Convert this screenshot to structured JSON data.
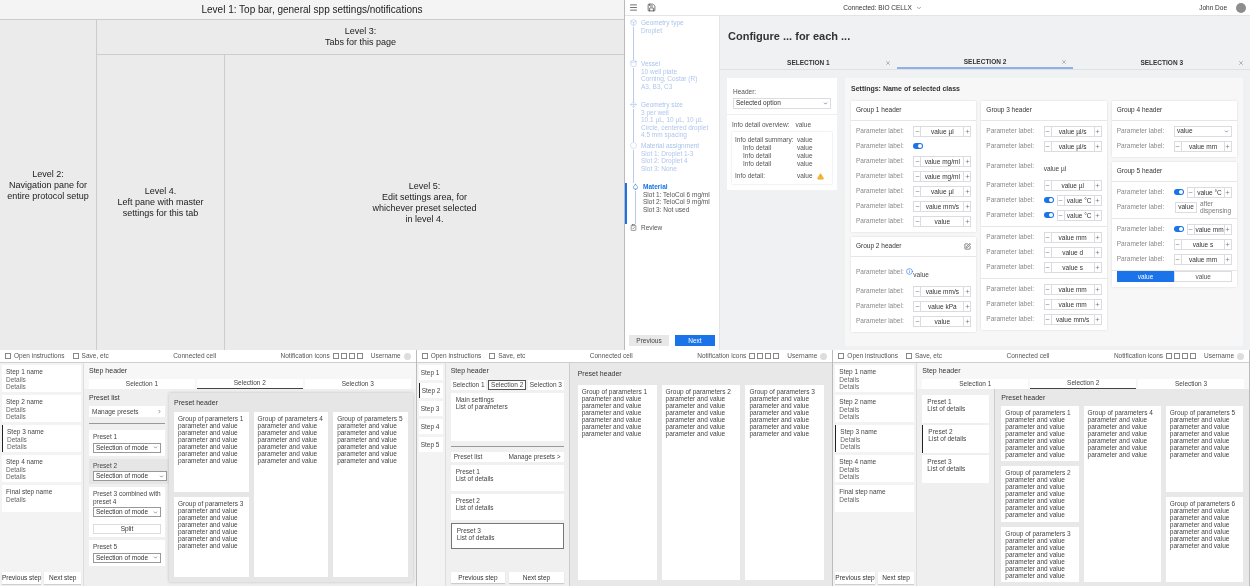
{
  "overview": {
    "level_1": "Level 1: Top bar, general spp settings/notifications",
    "level_2": "Level 2:\nNavigation pane for\nentire protocol setup",
    "level_3": "Level 3:\nTabs for this page",
    "level_4": "Level 4.\nLeft pane with master\nsettings for this tab",
    "level_5": "Level 5:\nEdit settings area, for\nwhichever preset selected\nin level 4."
  },
  "mockup": {
    "top_bar": {
      "connection": "Connected: BIO CELLX",
      "user": "John Doe"
    },
    "steps": [
      {
        "title": "Geometry type",
        "details": [
          "Droplet"
        ],
        "done": true,
        "selected": false
      },
      {
        "title": "Vessel",
        "details": [
          "10 well plate",
          "Corning, Costar (R)",
          "A3, B3, C3"
        ],
        "done": true,
        "selected": false
      },
      {
        "title": "Geometry size",
        "details": [
          "3 per well",
          "10.1 µL, 10 µL, 10 µL",
          "Circle, centered droplet",
          "4.5 mm spacing"
        ],
        "done": true,
        "selected": false
      },
      {
        "title": "Material assignment",
        "details": [
          "Slot 1: Droplet 1-3",
          "Slot 2: Droplet 4",
          "Slot 3: None"
        ],
        "done": true,
        "selected": false
      },
      {
        "title": "Material",
        "details": [
          "Slot 1: TeloCol 6 mg/ml",
          "Slot 2: TeloCol 9 mg/ml",
          "Slot 3: Not used"
        ],
        "done": false,
        "selected": true
      },
      {
        "title": "Review",
        "done": false,
        "selected": false
      }
    ],
    "previous": "Previous",
    "next": "Next",
    "title": "Configure ... for each ...",
    "tabs": [
      {
        "label": "SELECTION 1",
        "selected": false
      },
      {
        "label": "SELECTION 2",
        "selected": true
      },
      {
        "label": "SELECTION 3",
        "selected": false
      }
    ],
    "summary": {
      "header_label": "Header:",
      "dropdown": "Selected option",
      "overview_label": "Info detail overview:",
      "overview_value": "value",
      "details": [
        {
          "kind": "summary",
          "label": "Info detail summary:",
          "value": "value"
        },
        {
          "kind": "detail",
          "label": "Info detail",
          "value": "value"
        },
        {
          "kind": "detail",
          "label": "Info detail",
          "value": "value"
        },
        {
          "kind": "detail",
          "label": "Info detail",
          "value": "value"
        },
        {
          "kind": "warning",
          "label": "Info detail:",
          "value": "value"
        }
      ]
    },
    "settings": {
      "title": "Settings: Name of selected class",
      "columns": [
        [
          {
            "header": "Group 1 header",
            "editable": false,
            "sections": [
              [
                {
                  "kind": "stepper",
                  "label": "Parameter label:",
                  "value": "value µl"
                },
                {
                  "kind": "toggle",
                  "label": "Parameter label:",
                  "on": true
                },
                {
                  "kind": "stepper",
                  "label": "Parameter label:",
                  "value": "value mg/ml"
                },
                {
                  "kind": "stepper",
                  "label": "Parameter label:",
                  "value": "value mg/ml"
                },
                {
                  "kind": "stepper",
                  "label": "Parameter label:",
                  "value": "value µl"
                },
                {
                  "kind": "stepper",
                  "label": "Parameter label:",
                  "value": "value mm/s"
                },
                {
                  "kind": "stepper",
                  "label": "Parameter label:",
                  "value": "value"
                }
              ]
            ]
          },
          {
            "header": "Group 2 header",
            "editable": true,
            "sections": [
              [
                {
                  "kind": "info_text",
                  "label": "Parameter label:",
                  "value": "value"
                },
                {
                  "kind": "stepper",
                  "label": "Parameter label:",
                  "value": "value mm/s"
                },
                {
                  "kind": "stepper",
                  "label": "Parameter label:",
                  "value": "value kPa"
                },
                {
                  "kind": "stepper",
                  "label": "Parameter label:",
                  "value": "value"
                }
              ]
            ]
          }
        ],
        [
          {
            "header": "Group 3 header",
            "editable": false,
            "sections": [
              [
                {
                  "kind": "stepper",
                  "label": "Parameter label:",
                  "value": "value µl/s"
                },
                {
                  "kind": "stepper",
                  "label": "Parameter label:",
                  "value": "value µl/s"
                },
                {
                  "kind": "text",
                  "label": "Parameter label:",
                  "value": "value µl"
                },
                {
                  "kind": "stepper",
                  "label": "Parameter label:",
                  "value": "value µl"
                },
                {
                  "kind": "toggle_stepper",
                  "label": "Parameter label:",
                  "on": true,
                  "value": "value °C"
                },
                {
                  "kind": "toggle_stepper",
                  "label": "Parameter label:",
                  "on": true,
                  "value": "value °C"
                }
              ],
              [
                {
                  "kind": "stepper",
                  "label": "Parameter label:",
                  "value": "value mm"
                },
                {
                  "kind": "stepper",
                  "label": "Parameter label:",
                  "value": "value d"
                },
                {
                  "kind": "stepper",
                  "label": "Parameter label:",
                  "value": "value s"
                }
              ],
              [
                {
                  "kind": "stepper",
                  "label": "Parameter label:",
                  "value": "value mm"
                },
                {
                  "kind": "stepper",
                  "label": "Parameter label:",
                  "value": "value mm"
                },
                {
                  "kind": "stepper",
                  "label": "Parameter label:",
                  "value": "value mm/s"
                }
              ]
            ]
          }
        ],
        [
          {
            "header": "Group 4 header",
            "editable": false,
            "sections": [
              [
                {
                  "kind": "dropdown",
                  "label": "Parameter label:",
                  "value": "value"
                },
                {
                  "kind": "stepper",
                  "label": "Parameter label:",
                  "value": "value mm"
                }
              ]
            ]
          },
          {
            "header": "Group 5 header",
            "editable": false,
            "sections": [
              [
                {
                  "kind": "toggle_stepper",
                  "label": "Parameter label:",
                  "on": true,
                  "value": "value °C"
                },
                {
                  "kind": "field_suffix",
                  "label": "Parameter label:",
                  "value": "value",
                  "suffix": "after dispensing"
                }
              ],
              [
                {
                  "kind": "toggle_stepper",
                  "label": "Parameter label:",
                  "on": true,
                  "value": "value mm"
                },
                {
                  "kind": "stepper",
                  "label": "Parameter label:",
                  "value": "value s"
                },
                {
                  "kind": "stepper",
                  "label": "Parameter label:",
                  "value": "value mm"
                }
              ]
            ],
            "segmented": [
              {
                "label": "value",
                "selected": true
              },
              {
                "label": "value",
                "selected": false
              }
            ]
          }
        ]
      ]
    }
  },
  "wireframes": [
    {
      "kind": "preset_list",
      "top_bar": {
        "checkboxes": [
          {
            "label": "Open instructions",
            "checked": false
          },
          {
            "label": "Save, etc",
            "checked": false
          }
        ],
        "connection": "Connected cell",
        "notifications": "Notification icons",
        "user": "Username"
      },
      "steps": [
        {
          "title": "Step 1 name",
          "details": [
            "Details",
            "Details"
          ],
          "selected": false
        },
        {
          "title": "Step 2 name",
          "details": [
            "Details",
            "Details"
          ],
          "selected": false
        },
        {
          "title": "Step 3 name",
          "details": [
            "Details",
            "Details"
          ],
          "selected": true
        },
        {
          "title": "Step 4 name",
          "details": [
            "Details",
            "Details"
          ],
          "selected": false
        },
        {
          "title": "Final step name",
          "details": [
            "Details"
          ],
          "selected": false
        }
      ],
      "previous": "Previous step",
      "next": "Next step",
      "step_header": "Step header",
      "tabs": [
        {
          "label": "Selection 1",
          "selected": false
        },
        {
          "label": "Selection 2",
          "selected": true
        },
        {
          "label": "Selection 3",
          "selected": false
        }
      ],
      "preset_title": "Preset list",
      "manage": "Manage presets",
      "presets": [
        {
          "label": "Preset 1",
          "value": "Selection of mode",
          "selected": false
        },
        {
          "label": "Preset 2",
          "value": "Selection of mode",
          "selected": true
        },
        {
          "label": "Preset 3 combined with preset 4",
          "value": "Selection of mode",
          "action": "Split",
          "selected": false
        },
        {
          "label": "Preset 5",
          "value": "Selection of mode",
          "selected": false
        }
      ],
      "preset_header": "Preset header",
      "columns": [
        [
          {
            "title": "Group of parameters 1",
            "lines": [
              "parameter and value",
              "parameter and value",
              "parameter and value",
              "parameter and value",
              "parameter and value",
              "parameter and value"
            ]
          },
          {
            "title": "Group of parameters 3",
            "lines": [
              "parameter and value",
              "parameter and value",
              "parameter and value",
              "parameter and value",
              "parameter and value",
              "parameter and value"
            ]
          }
        ],
        [
          {
            "title": "Group of parameters 4",
            "lines": [
              "parameter and value",
              "parameter and value",
              "parameter and value",
              "parameter and value",
              "parameter and value",
              "parameter and value"
            ]
          }
        ],
        [
          {
            "title": "Group of parameters 5",
            "lines": [
              "parameter and value",
              "parameter and value",
              "parameter and value",
              "parameter and value",
              "parameter and value",
              "parameter and value"
            ]
          }
        ]
      ]
    },
    {
      "kind": "compact_steps",
      "top_bar": {
        "checkboxes": [
          {
            "label": "Open instructions",
            "checked": false
          },
          {
            "label": "Save, etc",
            "checked": false
          }
        ],
        "connection": "Connected cell",
        "notifications": "Notification icons",
        "user": "Username"
      },
      "steps": [
        {
          "title": "Step 1",
          "selected": false
        },
        {
          "title": "Step 2",
          "selected": true
        },
        {
          "title": "Step 3",
          "selected": false
        },
        {
          "title": "Step 4",
          "selected": false
        },
        {
          "title": "Step 5",
          "selected": false
        }
      ],
      "step_header": "Step header",
      "tabs": [
        {
          "label": "Selection 1",
          "selected": false
        },
        {
          "label": "Selection 2",
          "selected": true
        },
        {
          "label": "Selection 3",
          "selected": false
        }
      ],
      "main_settings": {
        "title": "Main settings",
        "detail": "List of parameters"
      },
      "preset_title": "Preset list",
      "manage": "Manage presets >",
      "presets": [
        {
          "title": "Preset 1",
          "detail": "List of details",
          "selected": false
        },
        {
          "title": "Preset 2",
          "detail": "List of details",
          "selected": false
        },
        {
          "title": "Preset 3",
          "detail": "List of details",
          "selected": true
        }
      ],
      "previous": "Previous step",
      "next": "Next step",
      "preset_header": "Preset header",
      "columns": [
        [
          {
            "title": "Group of parameters 1",
            "lines": [
              "parameter and value",
              "parameter and value",
              "parameter and value",
              "parameter and value",
              "parameter and value",
              "parameter and value"
            ]
          }
        ],
        [
          {
            "title": "Group of parameters 2",
            "lines": [
              "parameter and value",
              "parameter and value",
              "parameter and value",
              "parameter and value",
              "parameter and value",
              "parameter and value"
            ]
          }
        ],
        [
          {
            "title": "Group of parameters 3",
            "lines": [
              "parameter and value",
              "parameter and value",
              "parameter and value",
              "parameter and value",
              "parameter and value",
              "parameter and value"
            ]
          }
        ]
      ]
    },
    {
      "kind": "preset_cards",
      "top_bar": {
        "checkboxes": [
          {
            "label": "Open instructions",
            "checked": false
          },
          {
            "label": "Save, etc",
            "checked": false
          }
        ],
        "connection": "Connected cell",
        "notifications": "Notification icons",
        "user": "Username"
      },
      "steps": [
        {
          "title": "Step 1 name",
          "details": [
            "Details",
            "Details"
          ],
          "selected": false
        },
        {
          "title": "Step 2 name",
          "details": [
            "Details",
            "Details"
          ],
          "selected": false
        },
        {
          "title": "Step 3 name",
          "details": [
            "Details",
            "Details"
          ],
          "selected": true
        },
        {
          "title": "Step 4 name",
          "details": [
            "Details",
            "Details"
          ],
          "selected": false
        },
        {
          "title": "Final step name",
          "details": [
            "Details"
          ],
          "selected": false
        }
      ],
      "previous": "Previous step",
      "next": "Next step",
      "step_header": "Step header",
      "tabs": [
        {
          "label": "Selection 1",
          "selected": false
        },
        {
          "label": "Selection 2",
          "selected": true
        },
        {
          "label": "Selection 3",
          "selected": false
        }
      ],
      "presets": [
        {
          "title": "Preset 1",
          "detail": "List of details",
          "selected": false
        },
        {
          "title": "Preset 2",
          "detail": "List of details",
          "selected": true
        },
        {
          "title": "Preset 3",
          "detail": "List of details",
          "selected": false
        }
      ],
      "preset_header": "Preset header",
      "columns": [
        [
          {
            "title": "Group of parameters 1",
            "lines": [
              "parameter and value",
              "parameter and value",
              "parameter and value",
              "parameter and value",
              "parameter and value",
              "parameter and value"
            ]
          },
          {
            "title": "Group of parameters 2",
            "lines": [
              "parameter and value",
              "parameter and value",
              "parameter and value",
              "parameter and value",
              "parameter and value",
              "parameter and value"
            ]
          },
          {
            "title": "Group of parameters 3",
            "lines": [
              "parameter and value",
              "parameter and value",
              "parameter and value",
              "parameter and value",
              "parameter and value",
              "parameter and value"
            ]
          }
        ],
        [
          {
            "title": "Group of parameters 4",
            "lines": [
              "parameter and value",
              "parameter and value",
              "parameter and value",
              "parameter and value",
              "parameter and value",
              "parameter and value"
            ]
          }
        ],
        [
          {
            "title": "Group of parameters 5",
            "lines": [
              "parameter and value",
              "parameter and value",
              "parameter and value",
              "parameter and value",
              "parameter and value",
              "parameter and value"
            ]
          },
          {
            "title": "Group of parameters 6",
            "lines": [
              "parameter and value",
              "parameter and value",
              "parameter and value",
              "parameter and value",
              "parameter and value",
              "parameter and value"
            ]
          }
        ]
      ]
    }
  ]
}
